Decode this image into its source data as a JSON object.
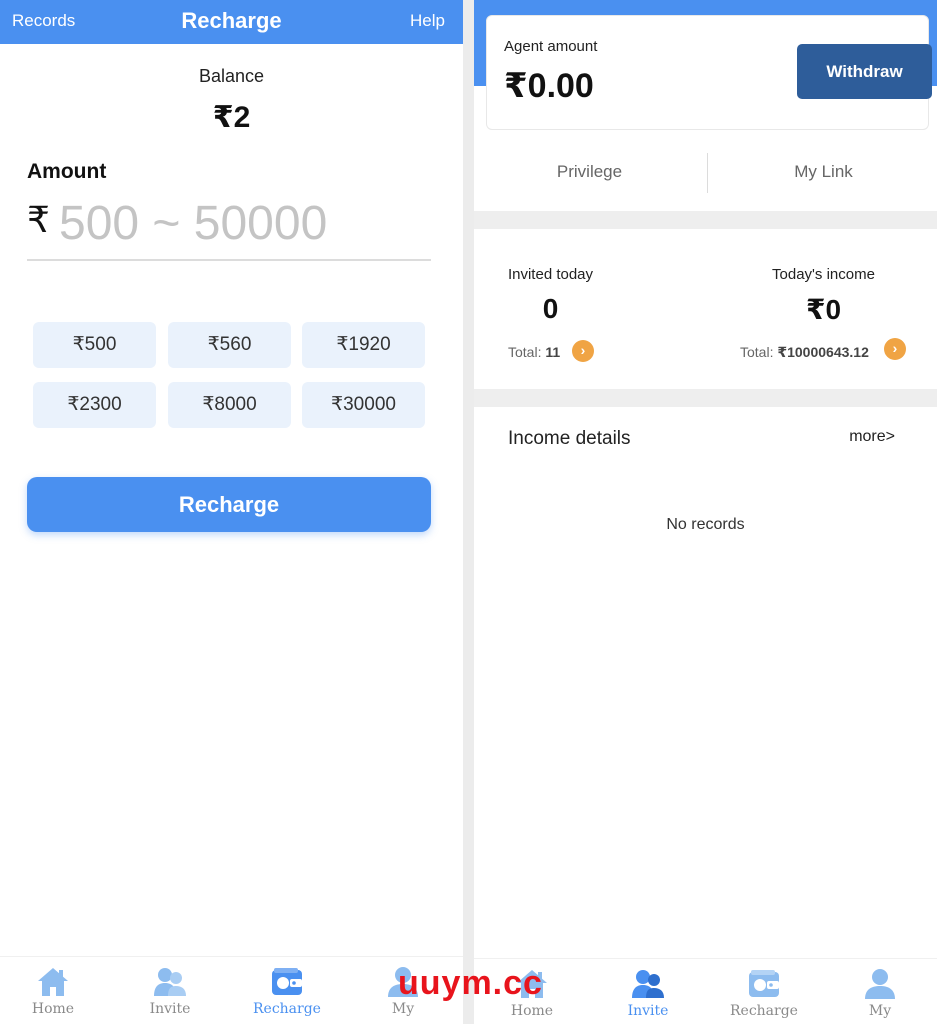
{
  "recharge_screen": {
    "header": {
      "records": "Records",
      "title": "Recharge",
      "help": "Help"
    },
    "balance": {
      "label": "Balance",
      "value": "₹2"
    },
    "amount": {
      "label": "Amount",
      "currency": "₹",
      "placeholder": "500 ~ 50000",
      "value": ""
    },
    "presets": [
      "₹500",
      "₹560",
      "₹1920",
      "₹2300",
      "₹8000",
      "₹30000"
    ],
    "recharge_button": "Recharge",
    "tabbar": {
      "active": "Recharge",
      "tabs": [
        "Home",
        "Invite",
        "Recharge",
        "My"
      ]
    }
  },
  "invite_screen": {
    "agent_card": {
      "label": "Agent amount",
      "value": "₹0.00",
      "withdraw": "Withdraw"
    },
    "subtabs": [
      "Privilege",
      "My Link"
    ],
    "stats": {
      "invited": {
        "label": "Invited today",
        "value": "0",
        "total_prefix": "Total:",
        "total": "11"
      },
      "income": {
        "label": "Today's income",
        "value": "₹0",
        "total_prefix": "Total:",
        "total": "₹10000643.12"
      }
    },
    "income_details": {
      "title": "Income details",
      "more": "more>",
      "empty": "No records"
    },
    "tabbar": {
      "active": "Invite",
      "tabs": [
        "Home",
        "Invite",
        "Recharge",
        "My"
      ]
    }
  },
  "watermark": "uuym.cc",
  "colors": {
    "primary": "#4a90f0",
    "withdraw": "#2e5d9a",
    "arrow": "#f0a444",
    "preset_bg": "#eaf2fc",
    "watermark": "#e8141c"
  },
  "icons": {
    "home": "home-icon",
    "invite": "invite-icon",
    "recharge": "wallet-icon",
    "my": "user-icon",
    "arrow": "chevron-right-icon"
  }
}
